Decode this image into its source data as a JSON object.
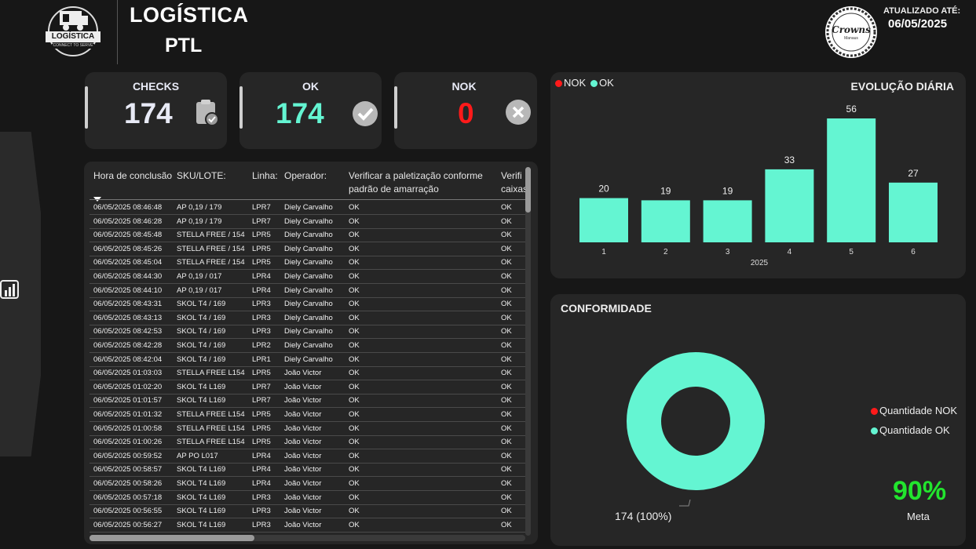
{
  "header": {
    "title_line1": "LOGÍSTICA",
    "title_line2": "PTL",
    "logo_text": "LOGÍSTICA",
    "logo_sub": "CONNECT TO SERVE",
    "updated_label": "ATUALIZADO ATÉ:",
    "updated_date": "06/05/2025",
    "brand_name": "Crowns",
    "brand_sub": "Manaus"
  },
  "cards": [
    {
      "label": "CHECKS",
      "value": "174",
      "color": "#e8eaf6",
      "icon": "clipboard-check-icon"
    },
    {
      "label": "OK",
      "value": "174",
      "color": "#64f5d2",
      "icon": "check-circle-icon"
    },
    {
      "label": "NOK",
      "value": "0",
      "color": "#ff1a1a",
      "icon": "x-circle-icon"
    }
  ],
  "table": {
    "headers": [
      "Hora de conclusão",
      "SKU/LOTE:",
      "Linha:",
      "Operador:",
      "Verificar a paletização conforme padrão de amarração",
      "Verificar caixas"
    ],
    "header_visible": [
      "Hora de conclusão",
      "SKU/LOTE:",
      "Linha:",
      "Operador:",
      "Verificar a paletização conforme",
      "padrão de amarração",
      "Verifi",
      "caixas"
    ],
    "sort_icon": "sort-down-icon",
    "rows": [
      [
        "06/05/2025 08:46:48",
        "AP 0,19 / 179",
        "LPR7",
        "Diely Carvalho",
        "OK",
        "OK"
      ],
      [
        "06/05/2025 08:46:28",
        "AP 0,19 / 179",
        "LPR7",
        "Diely Carvalho",
        "OK",
        "OK"
      ],
      [
        "06/05/2025 08:45:48",
        "STELLA FREE / 154",
        "LPR5",
        "Diely Carvalho",
        "OK",
        "OK"
      ],
      [
        "06/05/2025 08:45:26",
        "STELLA FREE / 154",
        "LPR5",
        "Diely Carvalho",
        "OK",
        "OK"
      ],
      [
        "06/05/2025 08:45:04",
        "STELLA FREE / 154",
        "LPR5",
        "Diely Carvalho",
        "OK",
        "OK"
      ],
      [
        "06/05/2025 08:44:30",
        "AP 0,19 / 017",
        "LPR4",
        "Diely Carvalho",
        "OK",
        "OK"
      ],
      [
        "06/05/2025 08:44:10",
        "AP 0,19 / 017",
        "LPR4",
        "Diely Carvalho",
        "OK",
        "OK"
      ],
      [
        "06/05/2025 08:43:31",
        "SKOL T4 / 169",
        "LPR3",
        "Diely Carvalho",
        "OK",
        "OK"
      ],
      [
        "06/05/2025 08:43:13",
        "SKOL T4 / 169",
        "LPR3",
        "Diely Carvalho",
        "OK",
        "OK"
      ],
      [
        "06/05/2025 08:42:53",
        "SKOL T4 / 169",
        "LPR3",
        "Diely Carvalho",
        "OK",
        "OK"
      ],
      [
        "06/05/2025 08:42:28",
        "SKOL T4 / 169",
        "LPR2",
        "Diely Carvalho",
        "OK",
        "OK"
      ],
      [
        "06/05/2025 08:42:04",
        "SKOL T4 / 169",
        "LPR1",
        "Diely Carvalho",
        "OK",
        "OK"
      ],
      [
        "06/05/2025 01:03:03",
        "STELLA FREE L154",
        "LPR5",
        "João Victor",
        "OK",
        "OK"
      ],
      [
        "06/05/2025 01:02:20",
        "SKOL T4 L169",
        "LPR7",
        "João Victor",
        "OK",
        "OK"
      ],
      [
        "06/05/2025 01:01:57",
        "SKOL T4 L169",
        "LPR7",
        "João Victor",
        "OK",
        "OK"
      ],
      [
        "06/05/2025 01:01:32",
        "STELLA FREE L154",
        "LPR5",
        "João Victor",
        "OK",
        "OK"
      ],
      [
        "06/05/2025 01:00:58",
        "STELLA FREE L154",
        "LPR5",
        "João Victor",
        "OK",
        "OK"
      ],
      [
        "06/05/2025 01:00:26",
        "STELLA FREE L154",
        "LPR5",
        "João Victor",
        "OK",
        "OK"
      ],
      [
        "06/05/2025 00:59:52",
        "AP PO L017",
        "LPR4",
        "João Victor",
        "OK",
        "OK"
      ],
      [
        "06/05/2025 00:58:57",
        "SKOL T4 L169",
        "LPR4",
        "João Victor",
        "OK",
        "OK"
      ],
      [
        "06/05/2025 00:58:26",
        "SKOL T4 L169",
        "LPR4",
        "João Victor",
        "OK",
        "OK"
      ],
      [
        "06/05/2025 00:57:18",
        "SKOL T4 L169",
        "LPR3",
        "João Victor",
        "OK",
        "OK"
      ],
      [
        "06/05/2025 00:56:55",
        "SKOL T4 L169",
        "LPR3",
        "João Victor",
        "OK",
        "OK"
      ],
      [
        "06/05/2025 00:56:27",
        "SKOL T4 L169",
        "LPR3",
        "João Victor",
        "OK",
        "OK"
      ]
    ]
  },
  "bar_panel": {
    "title": "EVOLUÇÃO DIÁRIA",
    "legend": [
      {
        "label": "NOK",
        "color": "#ff1a1a"
      },
      {
        "label": "OK",
        "color": "#64f5d2"
      }
    ]
  },
  "donut_panel": {
    "title": "CONFORMIDADE",
    "legend": [
      {
        "label": "Quantidade NOK",
        "color": "#ff1a1a"
      },
      {
        "label": "Quantidade OK",
        "color": "#64f5d2"
      }
    ],
    "data_label": "174 (100%)",
    "kpi_value": "90%",
    "kpi_label": "Meta",
    "kpi_color": "#22e52e"
  },
  "chart_data": [
    {
      "type": "bar",
      "title": "EVOLUÇÃO DIÁRIA",
      "categories": [
        "1",
        "2",
        "3",
        "4",
        "5",
        "6"
      ],
      "xlabel": "2025",
      "series": [
        {
          "name": "OK",
          "values": [
            20,
            19,
            19,
            33,
            56,
            27
          ],
          "color": "#64f5d2"
        },
        {
          "name": "NOK",
          "values": [
            0,
            0,
            0,
            0,
            0,
            0
          ],
          "color": "#ff1a1a"
        }
      ],
      "ylim": [
        0,
        56
      ],
      "data_labels": true,
      "legend": "top-left",
      "grid": false
    },
    {
      "type": "pie",
      "donut": true,
      "title": "CONFORMIDADE",
      "categories": [
        "Quantidade NOK",
        "Quantidade OK"
      ],
      "values": [
        0,
        174
      ],
      "colors": [
        "#ff1a1a",
        "#64f5d2"
      ],
      "legend": "right"
    }
  ]
}
